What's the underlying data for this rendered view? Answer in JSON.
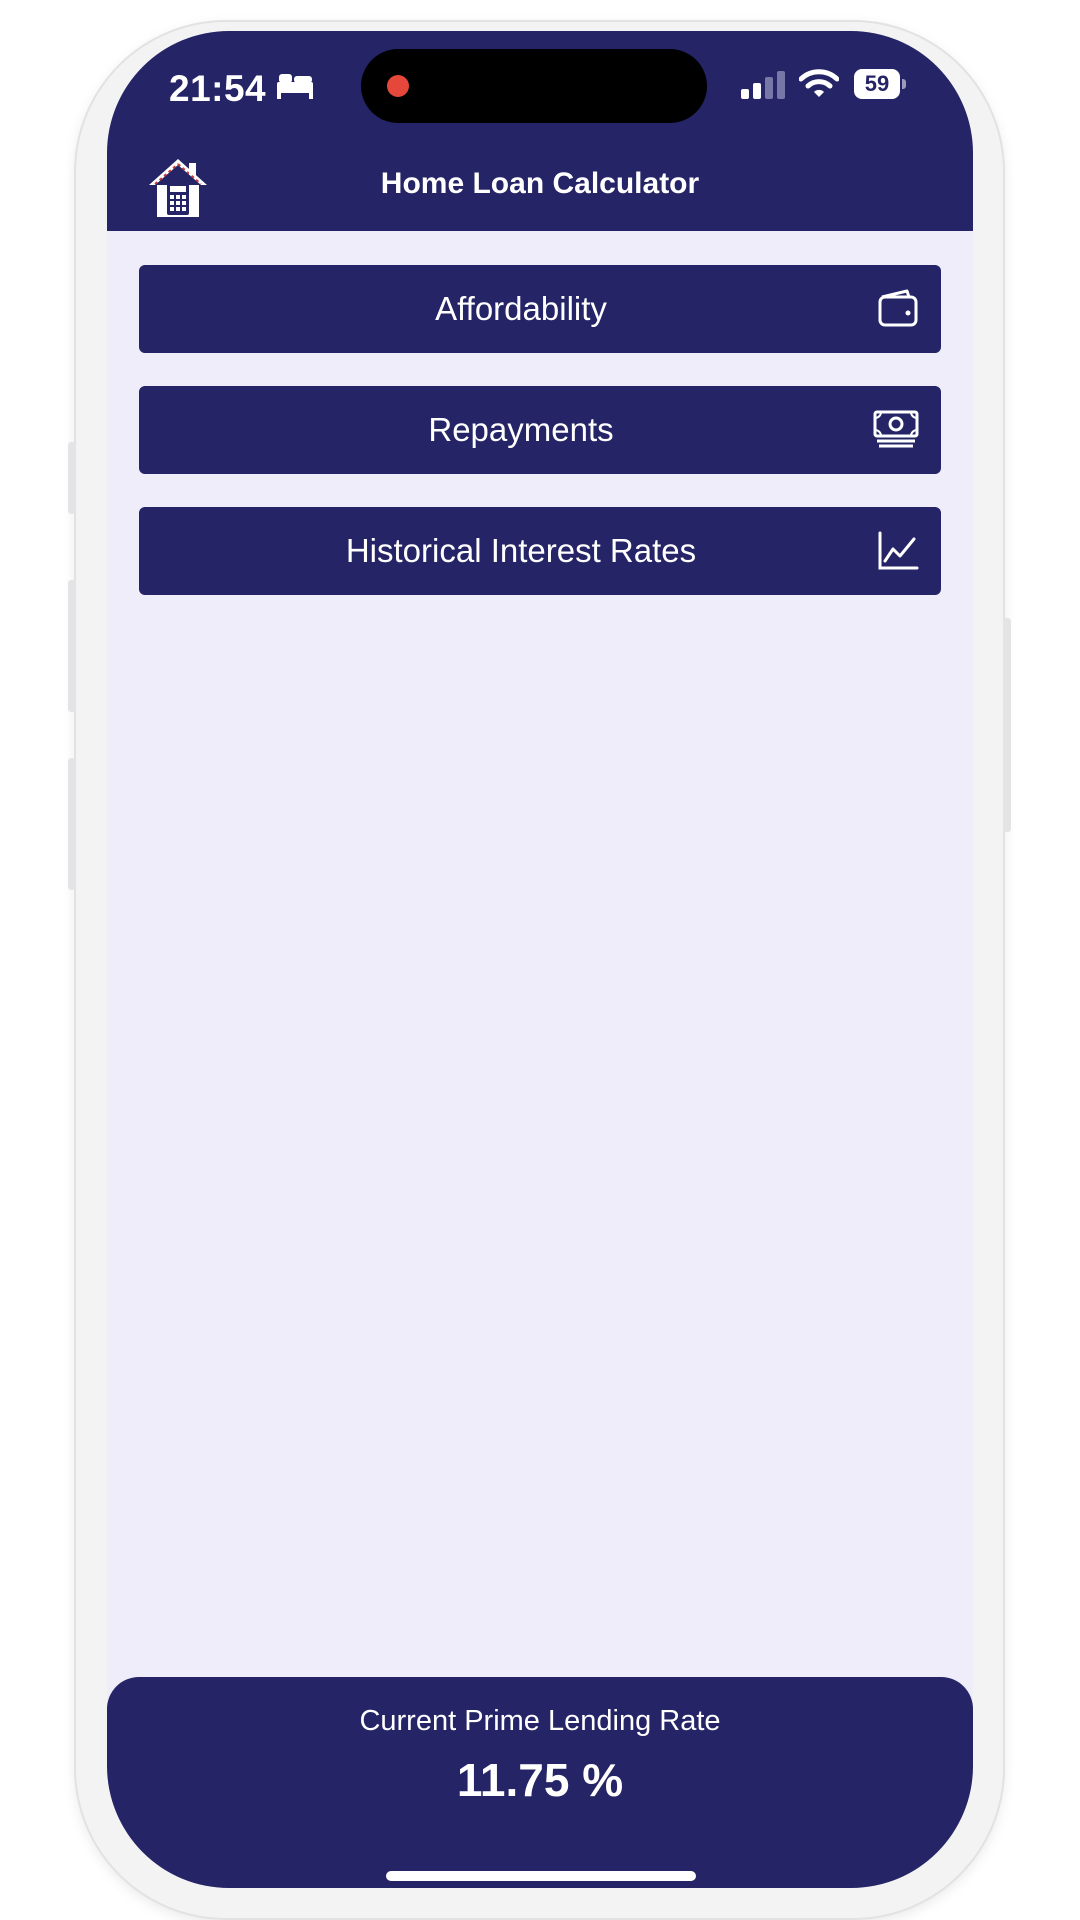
{
  "status_bar": {
    "time": "21:54",
    "battery_level": "59",
    "icons": [
      "bed-icon",
      "signal-icon",
      "wifi-icon",
      "battery-icon"
    ],
    "recording_dot_color": "#e5483a"
  },
  "header": {
    "title": "Home Loan Calculator",
    "logo_icon": "house-calculator-icon",
    "background_color": "#252466"
  },
  "menu": {
    "items": [
      {
        "label": "Affordability",
        "icon": "wallet-icon"
      },
      {
        "label": "Repayments",
        "icon": "banknotes-icon"
      },
      {
        "label": "Historical Interest Rates",
        "icon": "line-chart-icon"
      }
    ]
  },
  "footer": {
    "label": "Current Prime Lending Rate",
    "rate": "11.75 %"
  },
  "colors": {
    "primary": "#252466",
    "background": "#eeedf9",
    "text_on_primary": "#ffffff"
  }
}
